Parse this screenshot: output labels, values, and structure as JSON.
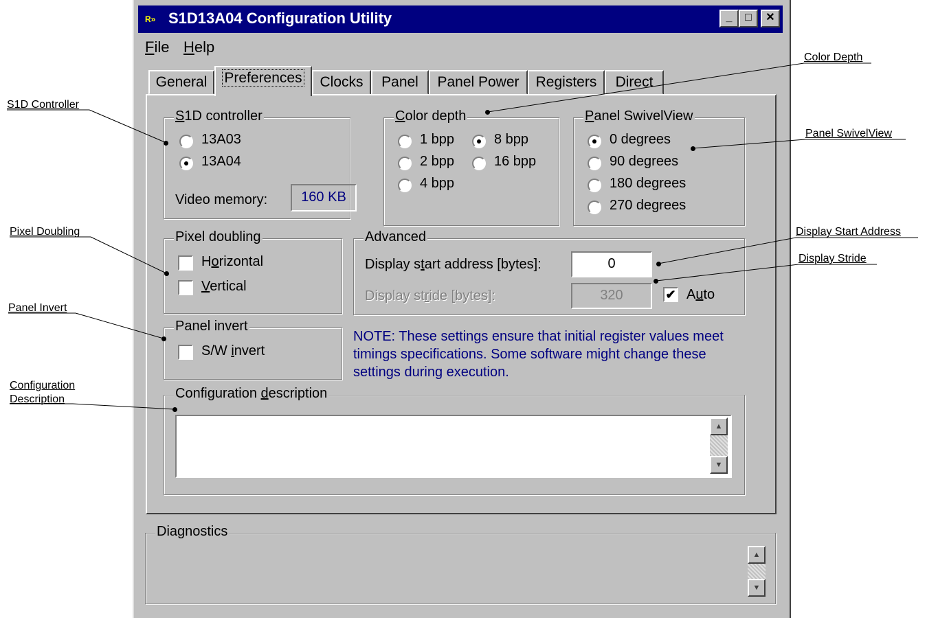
{
  "window": {
    "title": "S1D13A04 Configuration Utility",
    "icon_text": "R»",
    "controls": [
      "minimize-icon",
      "maximize-icon",
      "close-icon"
    ]
  },
  "menu": {
    "file": {
      "hotkey": "F",
      "rest": "ile"
    },
    "help": {
      "hotkey": "H",
      "rest": "elp"
    }
  },
  "tabs": [
    {
      "label": "General"
    },
    {
      "label": "Preferences",
      "active": true
    },
    {
      "label": "Clocks"
    },
    {
      "label": "Panel"
    },
    {
      "label": "Panel Power"
    },
    {
      "label": "Registers"
    },
    {
      "label": "Direct"
    }
  ],
  "s1d_controller": {
    "legend_hotkey": "S",
    "legend_rest": "1D controller",
    "options": [
      {
        "label": "13A03",
        "selected": false
      },
      {
        "label": "13A04",
        "selected": true
      }
    ],
    "video_memory_label": "Video memory:",
    "video_memory_value": "160 KB"
  },
  "color_depth": {
    "legend_hotkey": "C",
    "legend_rest": "olor depth",
    "options": [
      {
        "label": "1 bpp",
        "selected": false
      },
      {
        "label": "8 bpp",
        "selected": true
      },
      {
        "label": "2 bpp",
        "selected": false
      },
      {
        "label": "16 bpp",
        "selected": false
      },
      {
        "label": "4 bpp",
        "selected": false
      }
    ]
  },
  "swivelview": {
    "legend_hotkey": "P",
    "legend_rest": "anel SwivelView",
    "options": [
      {
        "label": "0 degrees",
        "selected": true
      },
      {
        "label": "90 degrees",
        "selected": false
      },
      {
        "label": "180 degrees",
        "selected": false
      },
      {
        "label": "270 degrees",
        "selected": false
      }
    ]
  },
  "pixel_doubling": {
    "legend": "Pixel doubling",
    "horizontal": {
      "pre": "H",
      "hotkey": "o",
      "rest": "rizontal",
      "checked": false
    },
    "vertical": {
      "pre": "",
      "hotkey": "V",
      "rest": "ertical",
      "checked": false
    }
  },
  "advanced": {
    "legend": "Advanced",
    "start_label_pre": "Display s",
    "start_hotkey": "t",
    "start_label_rest": "art address [bytes]:",
    "start_value": "0",
    "stride_label_pre": "Display st",
    "stride_hotkey": "r",
    "stride_label_rest": "ide [bytes]:",
    "stride_value": "320",
    "auto_pre": "A",
    "auto_hotkey": "u",
    "auto_rest": "to",
    "auto_checked": true,
    "auto_check_glyph": "✔"
  },
  "panel_invert": {
    "legend": "Panel invert",
    "pre": "S/W ",
    "hotkey": "i",
    "rest": "nvert",
    "checked": false
  },
  "note": "NOTE: These settings ensure that initial register values meet timings specifications.  Some software might change these settings during execution.",
  "config_desc": {
    "legend_pre": "Configuration ",
    "legend_hotkey": "d",
    "legend_rest": "escription",
    "value": ""
  },
  "diagnostics": {
    "legend": "Diagnostics"
  },
  "callouts": {
    "color_depth": "Color Depth",
    "s1d_controller": "S1D Controller",
    "panel_swivelview": "Panel SwivelView",
    "pixel_doubling": "Pixel Doubling",
    "display_start": "Display Start Address",
    "display_stride": "Display Stride",
    "panel_invert": "Panel Invert",
    "config_desc_line1": "Configuration",
    "config_desc_line2": "Description"
  },
  "colors": {
    "window_bg": "#c0c0c0",
    "title_bar": "#000080",
    "note_text": "#000080",
    "disabled_text": "#808080"
  }
}
